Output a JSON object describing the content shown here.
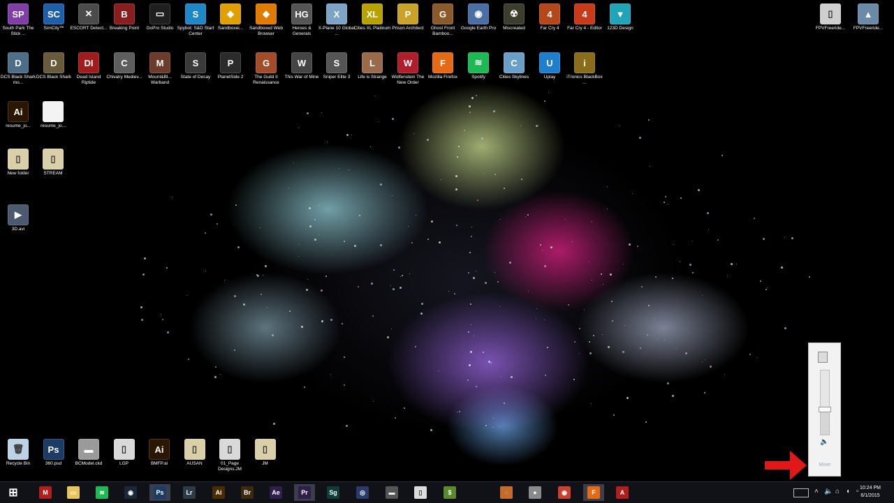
{
  "desktop": {
    "icons": [
      {
        "label": "South Park The Stick ...",
        "color": "#7f3fa6",
        "glyph": "SP"
      },
      {
        "label": "SimCity™",
        "color": "#1d5fa8",
        "glyph": "SC"
      },
      {
        "label": "ESCORT Detect...",
        "color": "#4b4b4b",
        "glyph": "✕"
      },
      {
        "label": "Breaking Point",
        "color": "#8a1e1e",
        "glyph": "B"
      },
      {
        "label": "GoPro Studio",
        "color": "#1f1f1f",
        "glyph": "▭"
      },
      {
        "label": "Spybot: S&D Start Center",
        "color": "#1e88c7",
        "glyph": "S"
      },
      {
        "label": "Sandboxei...",
        "color": "#e0a100",
        "glyph": "◆"
      },
      {
        "label": "Sandboxed Web Browser",
        "color": "#e07b00",
        "glyph": "◆"
      },
      {
        "label": "Heroes & Generals",
        "color": "#555555",
        "glyph": "HG"
      },
      {
        "label": "X-Plane 10 Global ...",
        "color": "#7da4c7",
        "glyph": "X"
      },
      {
        "label": "Cities XL Platinum",
        "color": "#b8a100",
        "glyph": "XL"
      },
      {
        "label": "Prison Architect",
        "color": "#c9a227",
        "glyph": "P"
      },
      {
        "label": "Ghost Front Bamboo...",
        "color": "#8b5a2b",
        "glyph": "G"
      },
      {
        "label": "Google Earth Pro",
        "color": "#4a6fa5",
        "glyph": "◉"
      },
      {
        "label": "Miscreated",
        "color": "#3d3d2b",
        "glyph": "☢"
      },
      {
        "label": "Far Cry 4",
        "color": "#b5471b",
        "glyph": "4"
      },
      {
        "label": "Far Cry 4 - Editor",
        "color": "#c93a1a",
        "glyph": "4"
      },
      {
        "label": "123D Design",
        "color": "#21a4b8",
        "glyph": "▼"
      },
      {
        "label": "DCS Black Shark mo...",
        "color": "#4c6e8a",
        "glyph": "D"
      },
      {
        "label": "DCS Black Shark",
        "color": "#6a5a3c",
        "glyph": "D"
      },
      {
        "label": "Dead Island Riptide",
        "color": "#a11d1d",
        "glyph": "DI"
      },
      {
        "label": "Chivalry Mediev...",
        "color": "#5e5e5e",
        "glyph": "C"
      },
      {
        "label": "Mount&Bl... Warband",
        "color": "#6b3b2b",
        "glyph": "M"
      },
      {
        "label": "State of Decay",
        "color": "#3a3a3a",
        "glyph": "S"
      },
      {
        "label": "PlanetSide 2",
        "color": "#2b2b2b",
        "glyph": "P"
      },
      {
        "label": "The Guild II Renaissance",
        "color": "#a34c2a",
        "glyph": "G"
      },
      {
        "label": "This War of Mine",
        "color": "#444444",
        "glyph": "W"
      },
      {
        "label": "Sniper Elite 3",
        "color": "#555555",
        "glyph": "S"
      },
      {
        "label": "Life is Strange",
        "color": "#9a6b4a",
        "glyph": "L"
      },
      {
        "label": "Wolfenstein The New Order",
        "color": "#b01e2a",
        "glyph": "W"
      },
      {
        "label": "Mozilla Firefox",
        "color": "#e66a14",
        "glyph": "F"
      },
      {
        "label": "Spotify",
        "color": "#1db954",
        "glyph": "≋"
      },
      {
        "label": "Cities Skylines",
        "color": "#6aa0c8",
        "glyph": "C"
      },
      {
        "label": "Uplay",
        "color": "#1e7fcf",
        "glyph": "U"
      },
      {
        "label": "iTronics BlackBox ...",
        "color": "#8a6d1a",
        "glyph": "i"
      },
      {
        "label": "resume_jo...",
        "color": "#2b1700",
        "glyph": "Ai"
      },
      {
        "label": "resume_jo...",
        "color": "#f3f3f3",
        "glyph": ""
      },
      {
        "label": "New folder",
        "color": "#d9cfa8",
        "glyph": "▯"
      },
      {
        "label": "STREAM",
        "color": "#d9cfa8",
        "glyph": "▯"
      },
      {
        "label": "3D.avi",
        "color": "#4b5a6e",
        "glyph": "▶"
      }
    ],
    "right_icons": [
      {
        "label": "FPVFreeride...",
        "color": "#cfcfcf",
        "glyph": "▯"
      },
      {
        "label": "FPVFreeride...",
        "color": "#6b8aa6",
        "glyph": "▲"
      }
    ],
    "bottom_icons": [
      {
        "label": "Recycle Bin",
        "color": "#bcd3e6",
        "glyph": "🗑"
      },
      {
        "label": "360.psd",
        "color": "#1b3c66",
        "glyph": "Ps"
      },
      {
        "label": "BCModel.ckd",
        "color": "#9a9a9a",
        "glyph": "▬"
      },
      {
        "label": "LGP",
        "color": "#d9d9d9",
        "glyph": "▯"
      },
      {
        "label": "BMFP.ai",
        "color": "#2b1700",
        "glyph": "Ai"
      },
      {
        "label": "AUSAN",
        "color": "#d9cfa8",
        "glyph": "▯"
      },
      {
        "label": "01_Page Designs.JM",
        "color": "#d9d9d9",
        "glyph": "▯"
      },
      {
        "label": "JM",
        "color": "#d9cfa8",
        "glyph": "▯"
      }
    ]
  },
  "volume_flyout": {
    "mixer_label": "Mixer",
    "level": 0.4
  },
  "taskbar": {
    "items": [
      {
        "name": "start-button",
        "glyph": "⊞",
        "color": "#101218",
        "active": false
      },
      {
        "name": "taskbar-mcafee",
        "glyph": "M",
        "color": "#b01e1e",
        "active": false
      },
      {
        "name": "taskbar-file-explorer",
        "glyph": "▭",
        "color": "#e8c65a",
        "active": false
      },
      {
        "name": "taskbar-spotify",
        "glyph": "≋",
        "color": "#1db954",
        "active": false
      },
      {
        "name": "taskbar-steam",
        "glyph": "◉",
        "color": "#1b2838",
        "active": false
      },
      {
        "name": "taskbar-photoshop",
        "glyph": "Ps",
        "color": "#1b3c66",
        "active": true
      },
      {
        "name": "taskbar-lightroom",
        "glyph": "Lr",
        "color": "#2d3a48",
        "active": false
      },
      {
        "name": "taskbar-illustrator",
        "glyph": "Ai",
        "color": "#4a2c00",
        "active": false
      },
      {
        "name": "taskbar-bridge",
        "glyph": "Br",
        "color": "#3b2a0e",
        "active": false
      },
      {
        "name": "taskbar-after-effects",
        "glyph": "Ae",
        "color": "#2e1f4d",
        "active": false
      },
      {
        "name": "taskbar-premiere",
        "glyph": "Pr",
        "color": "#2e1f4d",
        "active": true
      },
      {
        "name": "taskbar-speedgrade",
        "glyph": "Sg",
        "color": "#0f3b3b",
        "active": false
      },
      {
        "name": "taskbar-app-circle",
        "glyph": "◎",
        "color": "#2a3a6a",
        "active": false
      },
      {
        "name": "taskbar-keyboard-app",
        "glyph": "▬",
        "color": "#555555",
        "active": false
      },
      {
        "name": "taskbar-notepad",
        "glyph": "▯",
        "color": "#dcdcdc",
        "active": false
      },
      {
        "name": "taskbar-money-app",
        "glyph": "$",
        "color": "#5a8a2a",
        "active": false
      },
      {
        "name": "taskbar-origin",
        "glyph": "◌",
        "color": "#c46a2a",
        "active": false
      },
      {
        "name": "taskbar-chat-app",
        "glyph": "●",
        "color": "#8a8a8a",
        "active": false
      },
      {
        "name": "taskbar-chrome",
        "glyph": "◉",
        "color": "#c9412a",
        "active": false
      },
      {
        "name": "taskbar-firefox",
        "glyph": "F",
        "color": "#e66a14",
        "active": true
      },
      {
        "name": "taskbar-acrobat",
        "glyph": "A",
        "color": "#b01e1e",
        "active": false
      }
    ],
    "clock_time": "10:24 PM",
    "clock_date": "6/1/2015"
  },
  "colors": {
    "taskbar_bg": "#101218",
    "arrow": "#e01818"
  }
}
